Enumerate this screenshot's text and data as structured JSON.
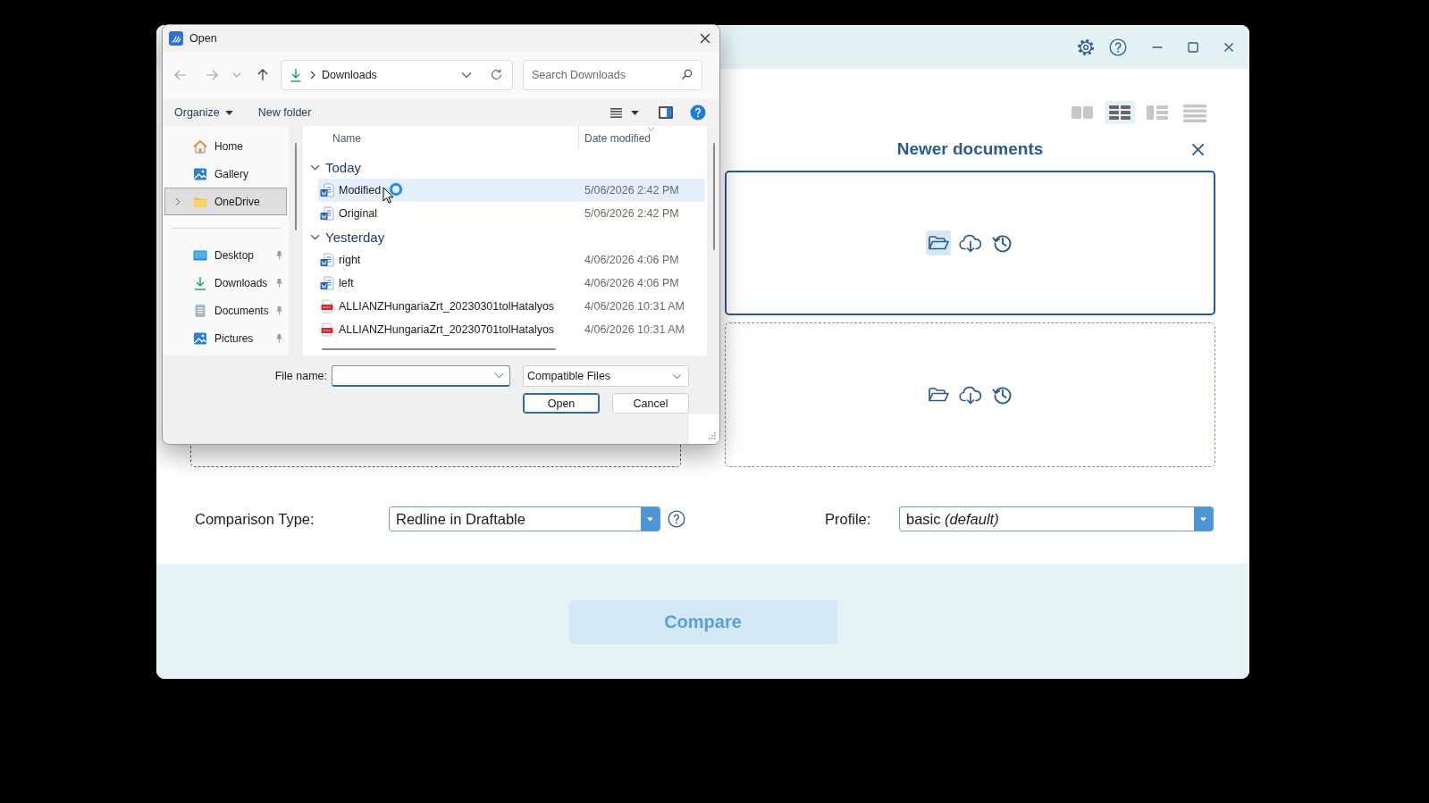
{
  "app": {
    "layouts": [
      {
        "kind": "two-panes",
        "selected": false
      },
      {
        "kind": "grid",
        "selected": true
      },
      {
        "kind": "split-list",
        "selected": false
      },
      {
        "kind": "list",
        "selected": false
      }
    ],
    "newer_panel": {
      "title": "Newer documents",
      "drop_zones": [
        {
          "focused": true
        },
        {
          "focused": false
        }
      ]
    },
    "left_panel": {
      "drop_zones": [
        {
          "focused": false
        }
      ]
    },
    "comparison_type": {
      "label": "Comparison Type:",
      "value": "Redline in Draftable"
    },
    "profile": {
      "label": "Profile:",
      "value": "basic *(default)*"
    },
    "compare_button": {
      "label": "Compare",
      "disabled": true
    }
  },
  "open_dialog": {
    "title": "Open",
    "location": "Downloads",
    "search": {
      "placeholder": "Search Downloads"
    },
    "toolbar": {
      "organize": "Organize",
      "new_folder": "New folder"
    },
    "nav_items": [
      {
        "label": "Home",
        "kind": "home",
        "selected": false,
        "expandable": false,
        "pinned": false
      },
      {
        "label": "Gallery",
        "kind": "gallery",
        "selected": false,
        "expandable": false,
        "pinned": false
      },
      {
        "label": "OneDrive",
        "kind": "folder",
        "selected": true,
        "expandable": true,
        "pinned": false
      }
    ],
    "quick_access": [
      {
        "label": "Desktop",
        "kind": "desktop",
        "selected": false,
        "expandable": false,
        "pinned": true
      },
      {
        "label": "Downloads",
        "kind": "downloads",
        "selected": false,
        "expandable": false,
        "pinned": true
      },
      {
        "label": "Documents",
        "kind": "documents",
        "selected": false,
        "expandable": false,
        "pinned": true
      },
      {
        "label": "Pictures",
        "kind": "pictures",
        "selected": false,
        "expandable": false,
        "pinned": true
      }
    ],
    "columns": [
      "Name",
      "Date modified"
    ],
    "groups": [
      {
        "label": "Today",
        "expanded": true,
        "files": [
          {
            "name": "Modified",
            "date": "5/06/2026 2:42 PM",
            "kind": "word",
            "selected": true
          },
          {
            "name": "Original",
            "date": "5/06/2026 2:42 PM",
            "kind": "word",
            "selected": false
          }
        ]
      },
      {
        "label": "Yesterday",
        "expanded": true,
        "files": [
          {
            "name": "right",
            "date": "4/06/2026 4:06 PM",
            "kind": "word",
            "selected": false
          },
          {
            "name": "left",
            "date": "4/06/2026 4:06 PM",
            "kind": "word",
            "selected": false
          },
          {
            "name": "ALLIANZHungariaZrt_20230301tolHatalyos",
            "date": "4/06/2026 10:31 AM",
            "kind": "pdf",
            "selected": false
          },
          {
            "name": "ALLIANZHungariaZrt_20230701tolHatalyos",
            "date": "4/06/2026 10:31 AM",
            "kind": "pdf",
            "selected": false
          }
        ]
      }
    ],
    "file_name": {
      "label": "File name:"
    },
    "file_type": "Compatible Files",
    "buttons": [
      {
        "label": "Open",
        "default": true
      },
      {
        "label": "Cancel",
        "default": false
      }
    ]
  }
}
